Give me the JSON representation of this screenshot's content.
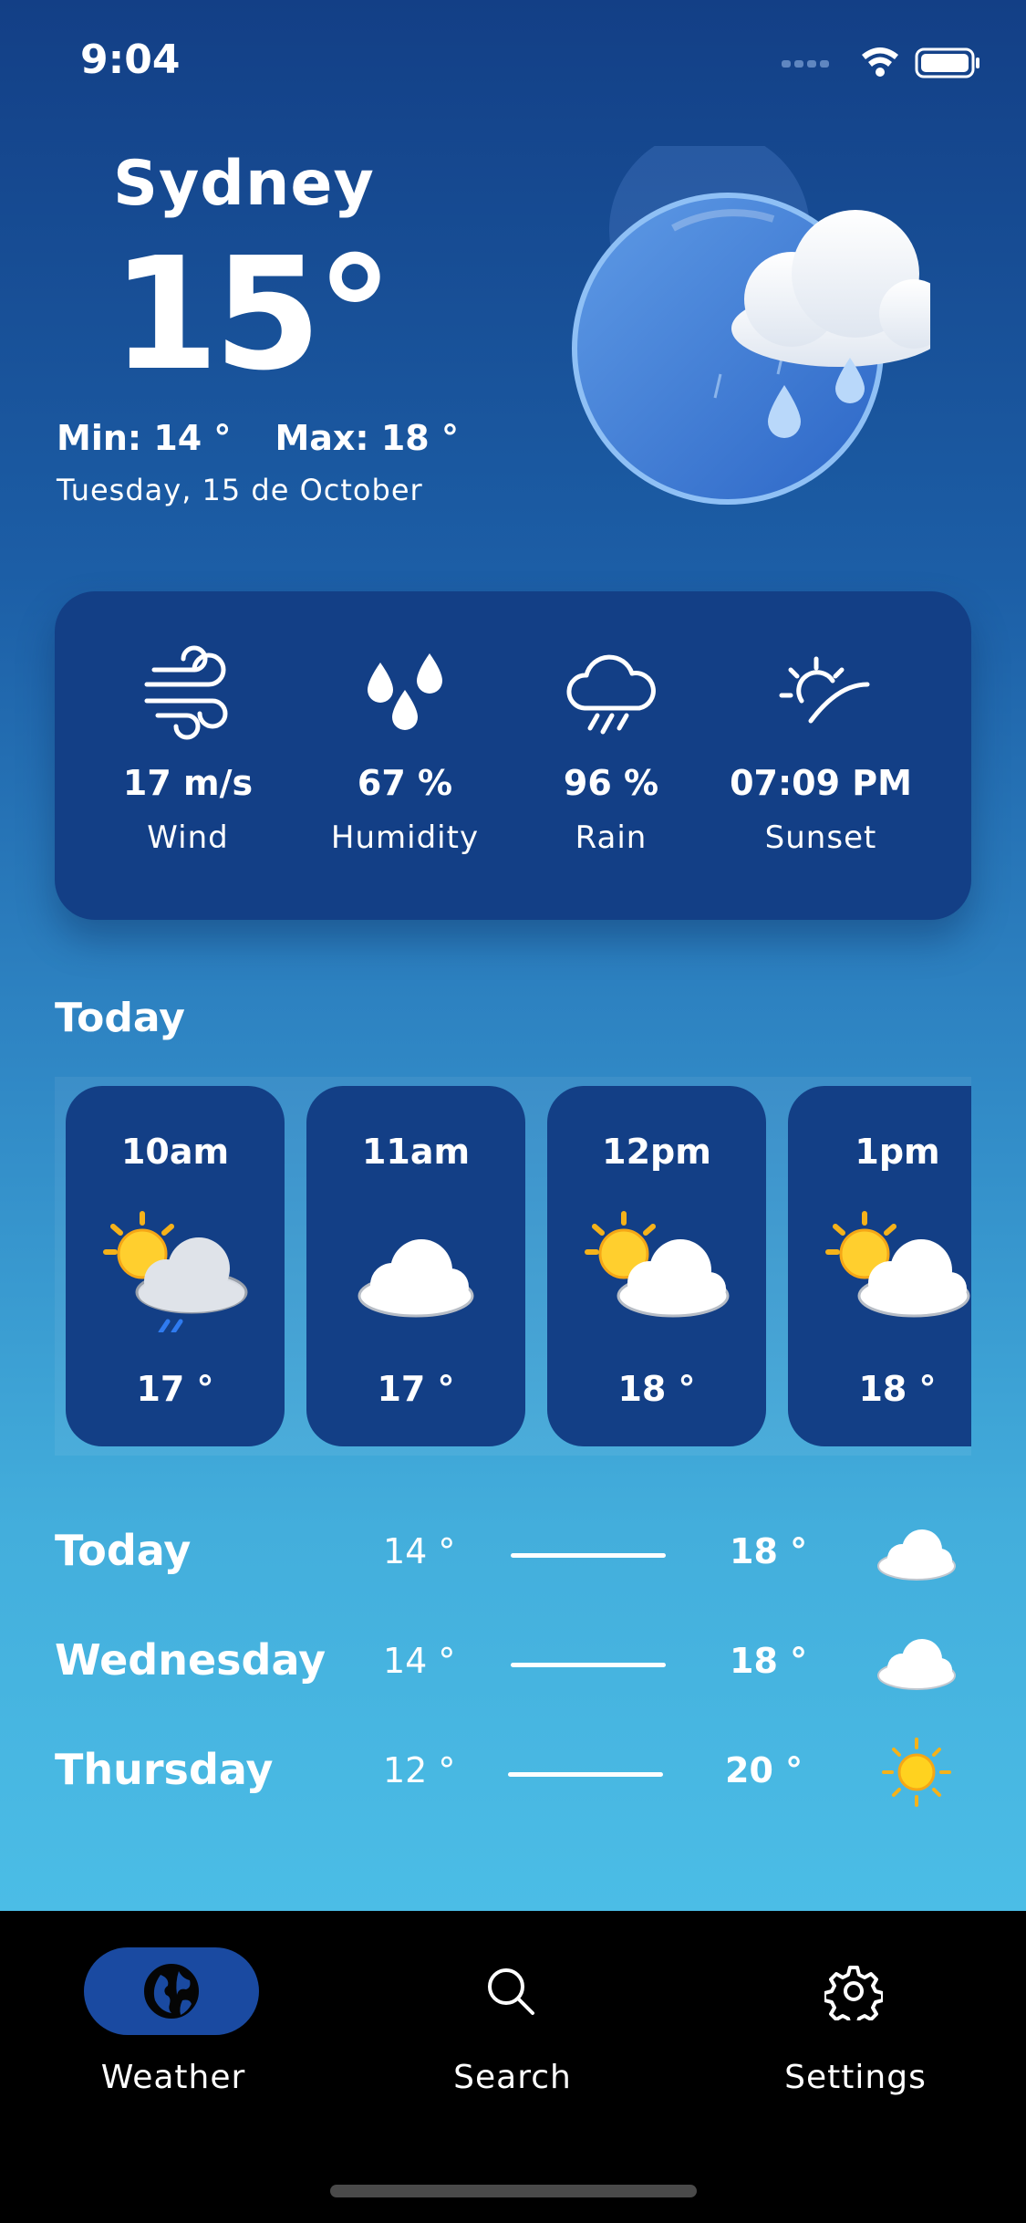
{
  "status_bar": {
    "time": "9:04"
  },
  "current": {
    "city": "Sydney",
    "temperature": "15°",
    "min": "Min: 14 °",
    "max": "Max: 18 °",
    "date": "Tuesday, 15 de October",
    "icon": "rain-cloud-icon"
  },
  "stats": [
    {
      "value": "17 m/s",
      "label": "Wind",
      "icon": "wind-icon"
    },
    {
      "value": "67 %",
      "label": "Humidity",
      "icon": "humidity-icon"
    },
    {
      "value": "96 %",
      "label": "Rain",
      "icon": "rain-icon"
    },
    {
      "value": "07:09 PM",
      "label": "Sunset",
      "icon": "sunset-icon"
    }
  ],
  "today_section": {
    "title": "Today"
  },
  "hourly": [
    {
      "time": "10am",
      "temp": "17 °",
      "icon": "sun-cloud-rain-icon"
    },
    {
      "time": "11am",
      "temp": "17 °",
      "icon": "cloud-icon"
    },
    {
      "time": "12pm",
      "temp": "18 °",
      "icon": "sun-cloud-icon"
    },
    {
      "time": "1pm",
      "temp": "18 °",
      "icon": "sun-cloud-icon"
    }
  ],
  "daily": [
    {
      "day": "Today",
      "min": "14 °",
      "max": "18 °",
      "icon": "cloud-icon"
    },
    {
      "day": "Wednesday",
      "min": "14 °",
      "max": "18 °",
      "icon": "cloud-icon"
    },
    {
      "day": "Thursday",
      "min": "12 °",
      "max": "20 °",
      "icon": "sun-icon"
    }
  ],
  "tabs": [
    {
      "label": "Weather",
      "icon": "globe-icon",
      "active": true
    },
    {
      "label": "Search",
      "icon": "search-icon",
      "active": false
    },
    {
      "label": "Settings",
      "icon": "gear-icon",
      "active": false
    }
  ],
  "colors": {
    "card": "#133f86",
    "gradient_top": "#133f86",
    "gradient_bottom": "#4bbde6",
    "active_tab": "#1a4aa1"
  }
}
